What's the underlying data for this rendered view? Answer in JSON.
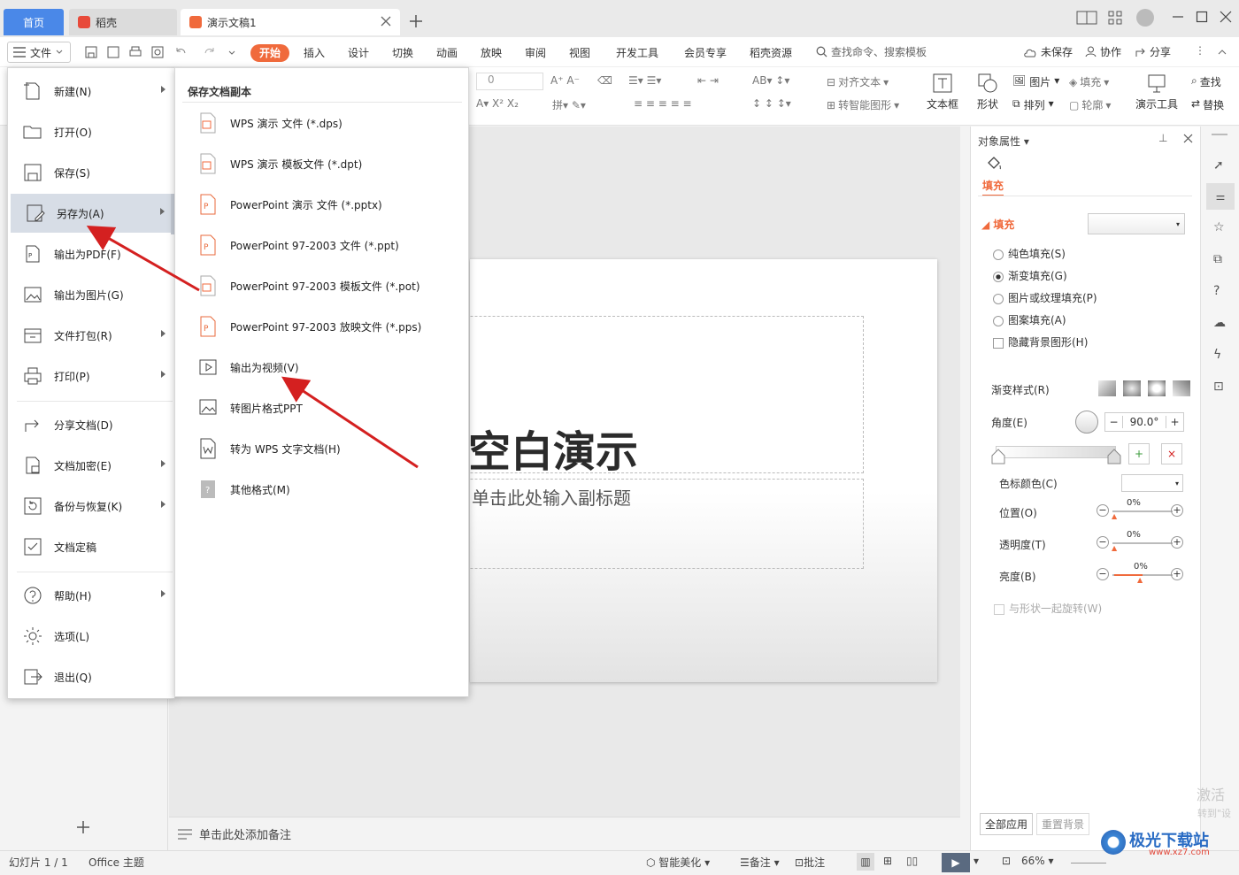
{
  "titlebar": {
    "tabs": [
      {
        "label": "首页"
      },
      {
        "label": "稻壳"
      },
      {
        "label": "演示文稿1"
      }
    ]
  },
  "menubar": {
    "file_label": "文件",
    "tabs": [
      "开始",
      "插入",
      "设计",
      "切换",
      "动画",
      "放映",
      "审阅",
      "视图",
      "开发工具",
      "会员专享",
      "稻壳资源"
    ],
    "search_placeholder": "查找命令、搜索模板",
    "unsaved": "未保存",
    "collaborate": "协作",
    "share": "分享"
  },
  "ribbon": {
    "font_size": "0",
    "align_text": "对齐文本",
    "smart_shape": "转智能图形",
    "textbox": "文本框",
    "shape": "形状",
    "picture": "图片",
    "arrange": "排列",
    "fill": "填充",
    "outline": "轮廓",
    "presentation_tools": "演示工具",
    "find": "查找",
    "replace": "替换"
  },
  "file_menu": {
    "items": [
      {
        "label": "新建(N)",
        "icon": "new-file-icon",
        "submenu": true
      },
      {
        "label": "打开(O)",
        "icon": "folder-open-icon",
        "submenu": false
      },
      {
        "label": "保存(S)",
        "icon": "save-icon",
        "submenu": false
      },
      {
        "label": "另存为(A)",
        "icon": "save-as-icon",
        "submenu": true
      },
      {
        "label": "输出为PDF(F)",
        "icon": "pdf-export-icon",
        "submenu": false
      },
      {
        "label": "输出为图片(G)",
        "icon": "image-export-icon",
        "submenu": false
      },
      {
        "label": "文件打包(R)",
        "icon": "package-icon",
        "submenu": true
      },
      {
        "label": "打印(P)",
        "icon": "print-icon",
        "submenu": true
      },
      {
        "label": "分享文档(D)",
        "icon": "share-icon",
        "submenu": false
      },
      {
        "label": "文档加密(E)",
        "icon": "encrypt-icon",
        "submenu": true
      },
      {
        "label": "备份与恢复(K)",
        "icon": "backup-icon",
        "submenu": true
      },
      {
        "label": "文档定稿",
        "icon": "finalize-icon",
        "submenu": false
      },
      {
        "label": "帮助(H)",
        "icon": "help-icon",
        "submenu": true
      },
      {
        "label": "选项(L)",
        "icon": "settings-icon",
        "submenu": false
      },
      {
        "label": "退出(Q)",
        "icon": "exit-icon",
        "submenu": false
      }
    ]
  },
  "save_as_menu": {
    "header": "保存文档副本",
    "items": [
      {
        "label": "WPS 演示 文件 (*.dps)",
        "icon": "dps-file-icon"
      },
      {
        "label": "WPS 演示 模板文件 (*.dpt)",
        "icon": "dpt-file-icon"
      },
      {
        "label": "PowerPoint 演示 文件 (*.pptx)",
        "icon": "pptx-file-icon"
      },
      {
        "label": "PowerPoint 97-2003 文件 (*.ppt)",
        "icon": "ppt-file-icon"
      },
      {
        "label": "PowerPoint 97-2003 模板文件 (*.pot)",
        "icon": "pot-file-icon"
      },
      {
        "label": "PowerPoint 97-2003 放映文件 (*.pps)",
        "icon": "pps-file-icon"
      },
      {
        "label": "输出为视频(V)",
        "icon": "video-export-icon"
      },
      {
        "label": "转图片格式PPT",
        "icon": "image-ppt-icon"
      },
      {
        "label": "转为 WPS 文字文档(H)",
        "icon": "wps-writer-icon"
      },
      {
        "label": "其他格式(M)",
        "icon": "other-format-icon"
      }
    ]
  },
  "slide": {
    "title": "空白演示",
    "subtitle": "单击此处输入副标题",
    "notes_placeholder": "单击此处添加备注"
  },
  "properties": {
    "header": "对象属性",
    "tab_fill": "填充",
    "section_fill": "填充",
    "options": [
      {
        "label": "纯色填充(S)",
        "type": "radio",
        "checked": false
      },
      {
        "label": "渐变填充(G)",
        "type": "radio",
        "checked": true
      },
      {
        "label": "图片或纹理填充(P)",
        "type": "radio",
        "checked": false
      },
      {
        "label": "图案填充(A)",
        "type": "radio",
        "checked": false
      },
      {
        "label": "隐藏背景图形(H)",
        "type": "checkbox",
        "checked": false
      }
    ],
    "gradient_style": "渐变样式(R)",
    "angle_label": "角度(E)",
    "angle_value": "90.0°",
    "stop_color": "色标颜色(C)",
    "position": {
      "label": "位置(O)",
      "value": "0%"
    },
    "transparency": {
      "label": "透明度(T)",
      "value": "0%"
    },
    "brightness": {
      "label": "亮度(B)",
      "value": "0%"
    },
    "rotate_with_shape": "与形状一起旋转(W)",
    "apply_all": "全部应用",
    "reset_bg": "重置背景"
  },
  "statusbar": {
    "slide_count": "幻灯片 1 / 1",
    "theme": "Office 主题",
    "smart_beautify": "智能美化",
    "notes": "备注",
    "comments": "批注",
    "zoom": "66%"
  },
  "watermark": {
    "activate": "激活",
    "goto": "转到\"设",
    "site_name": "极光下载站",
    "site_url": "www.xz7.com"
  },
  "colors": {
    "accent_orange": "#f06a3c",
    "home_tab_blue": "#4a88e8",
    "arrow_red": "#d42020"
  }
}
